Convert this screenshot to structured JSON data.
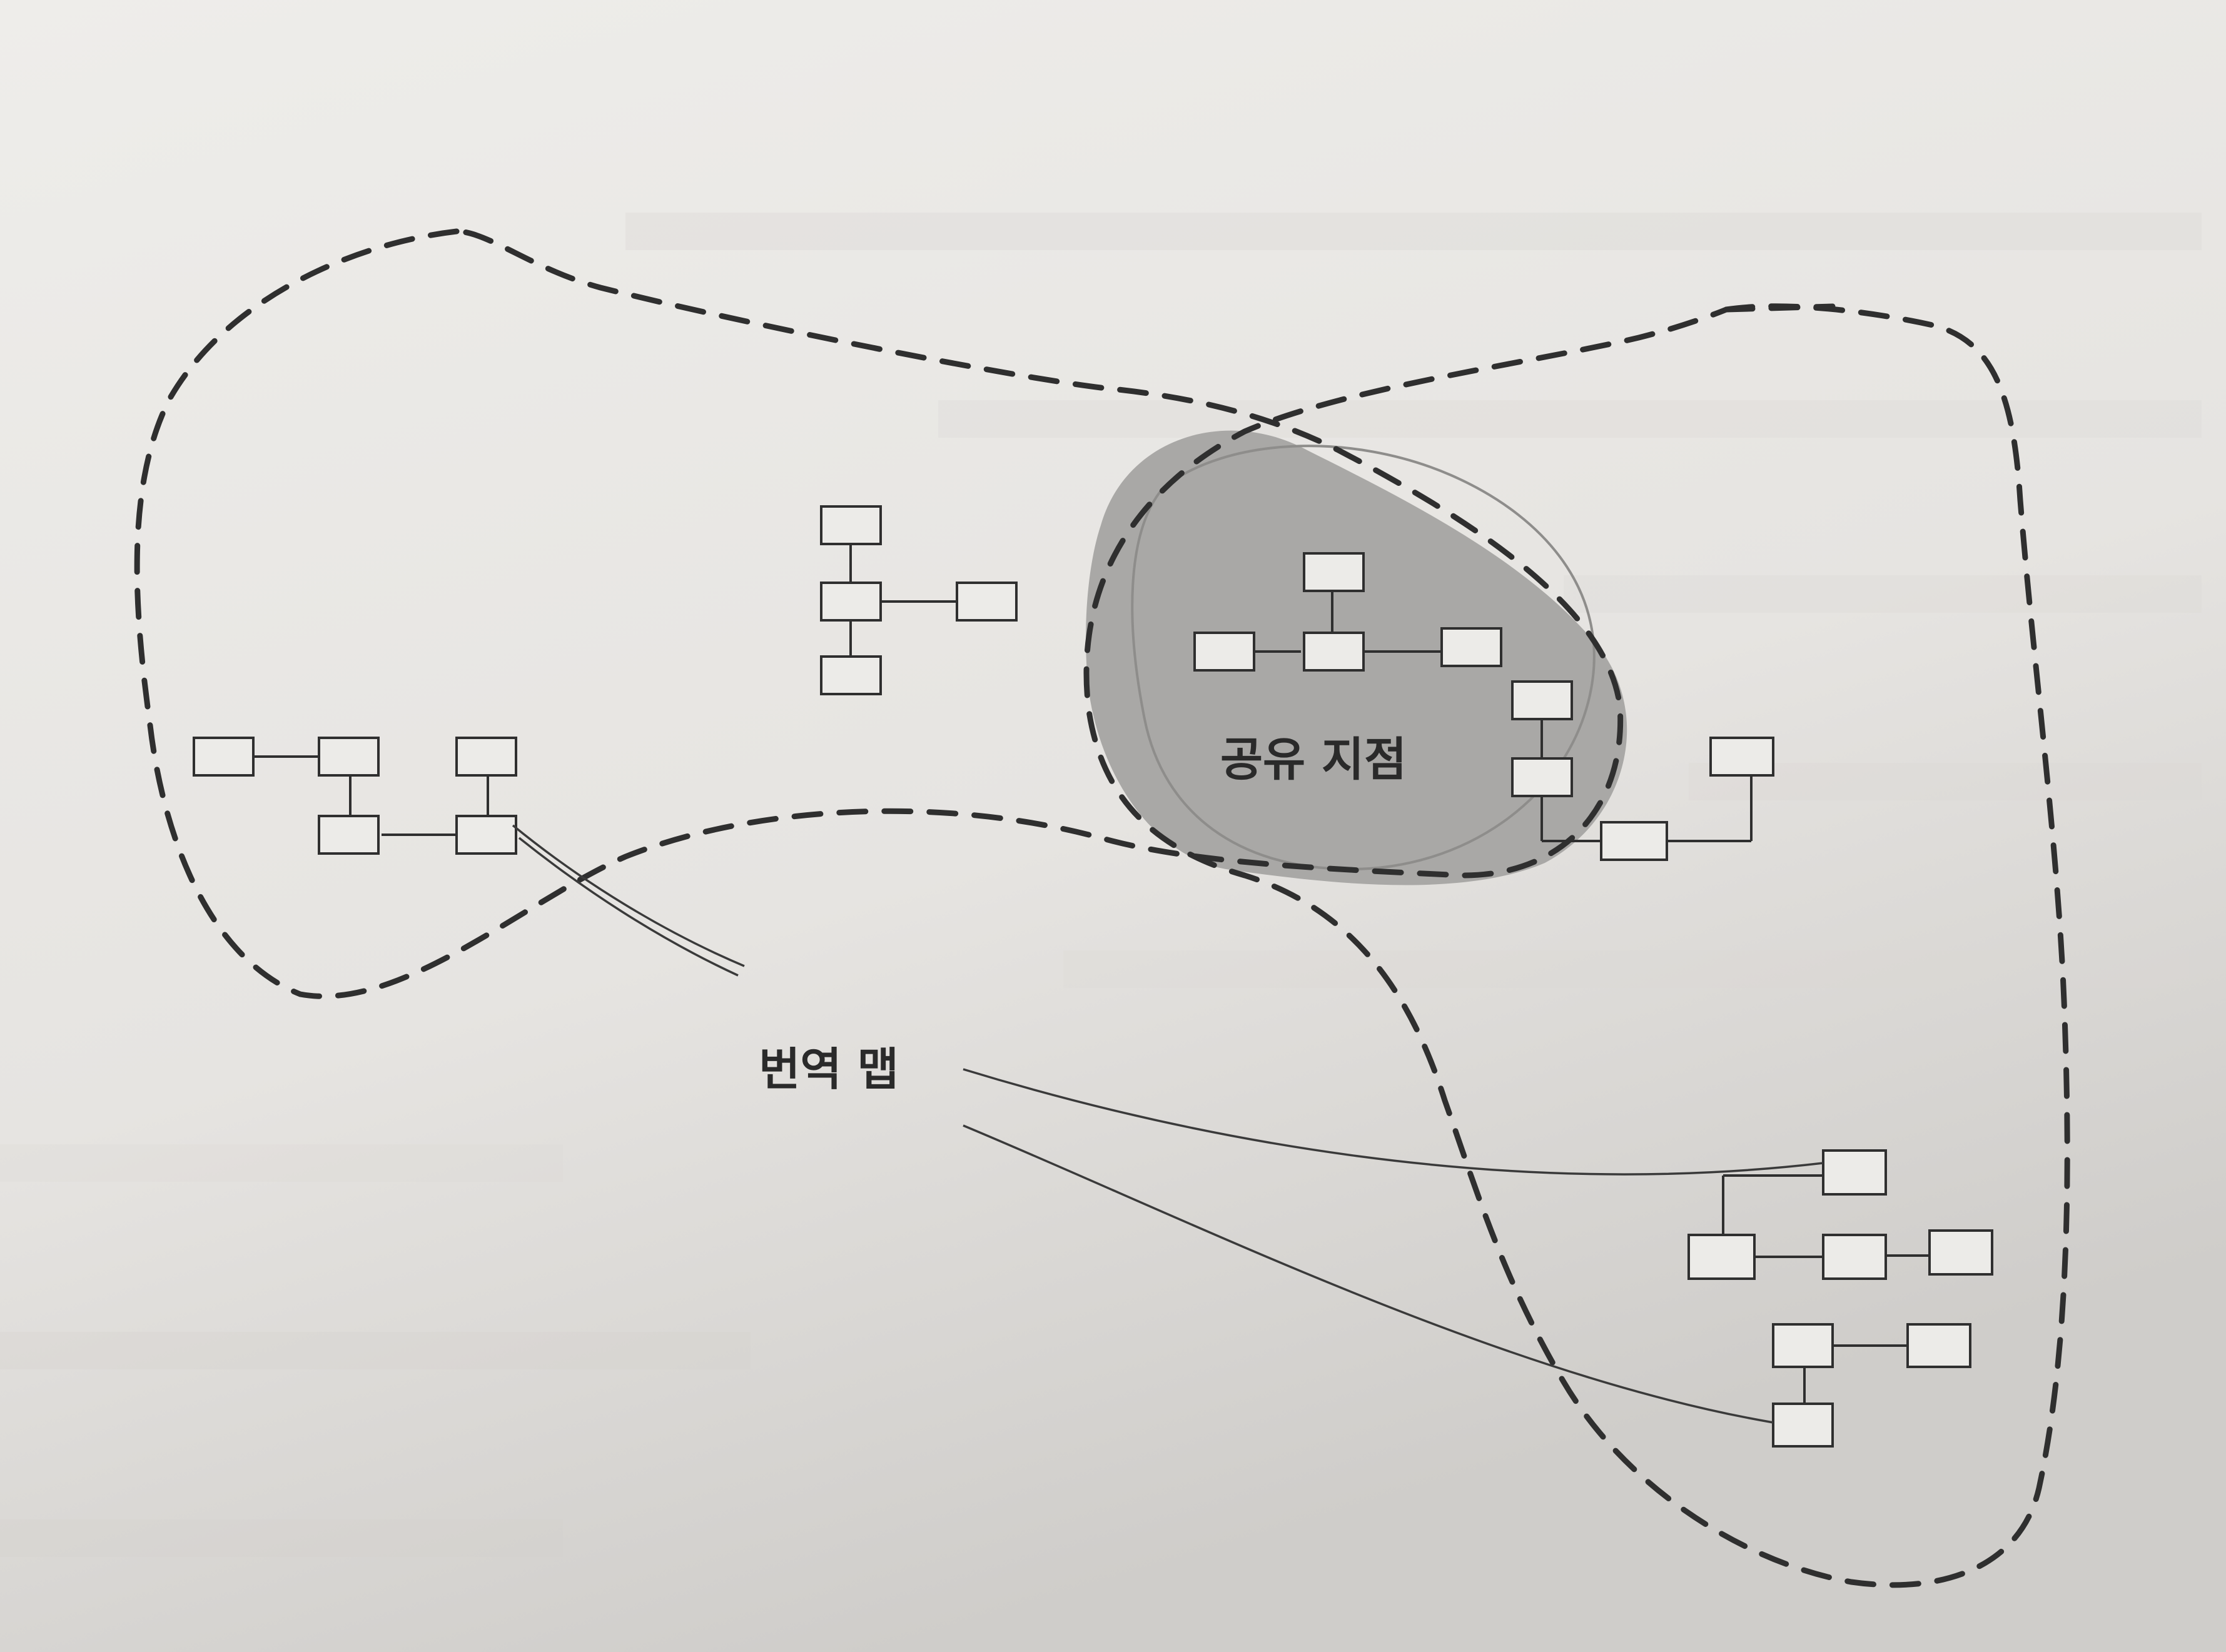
{
  "labels": {
    "shared_kernel": "공유 지점",
    "translation_map": "번역 맵"
  },
  "colors": {
    "paper": "#e9e7e4",
    "shared_region": "#a9a8a6",
    "ink": "#2f2f2f"
  }
}
